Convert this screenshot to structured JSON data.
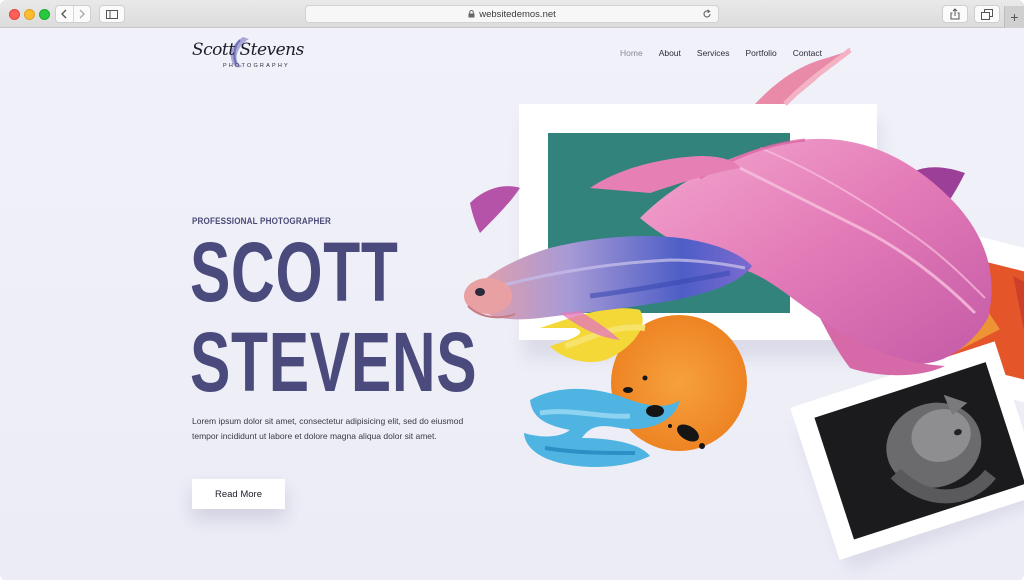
{
  "browser": {
    "url": "websitedemos.net"
  },
  "logo": {
    "script_text": "Scott Stevens",
    "subtitle": "PHOTOGRAPHY"
  },
  "nav": {
    "items": [
      {
        "label": "Home",
        "active": true
      },
      {
        "label": "About",
        "active": false
      },
      {
        "label": "Services",
        "active": false
      },
      {
        "label": "Portfolio",
        "active": false
      },
      {
        "label": "Contact",
        "active": false
      }
    ]
  },
  "hero": {
    "eyebrow": "PROFESSIONAL PHOTOGRAPHER",
    "headline_line1": "SCOTT",
    "headline_line2": "STEVENS",
    "body": "Lorem ipsum dolor sit amet, consectetur adipisicing elit, sed do eiusmod tempor incididunt ut labore et dolore magna aliqua dolor sit amet.",
    "cta_label": "Read More"
  },
  "colors": {
    "headline": "#4a4a7d",
    "page_background": "#eeeff8",
    "fish_pink": "#e07ab4",
    "fish_blue": "#4c5cc8",
    "frame_teal": "#2f7d78",
    "sun_orange": "#f2922d"
  }
}
